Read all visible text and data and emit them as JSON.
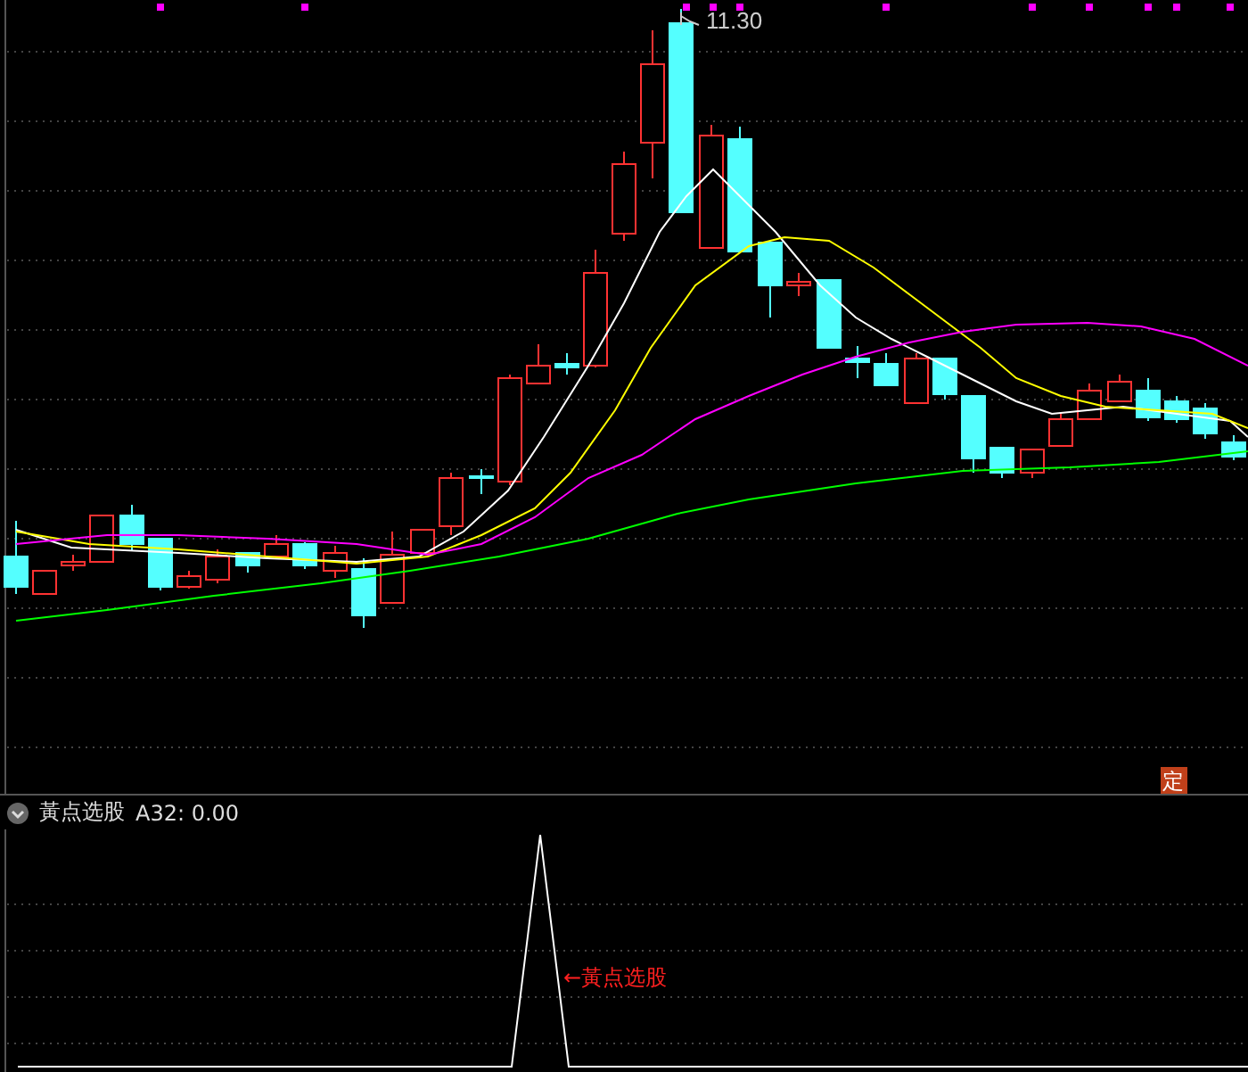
{
  "main_chart": {
    "high_label": "11.30",
    "badge": "定"
  },
  "indicator_panel": {
    "name": "黃点选股",
    "reading": "A32: 0.00",
    "signal_label": "←黃点选股"
  }
}
